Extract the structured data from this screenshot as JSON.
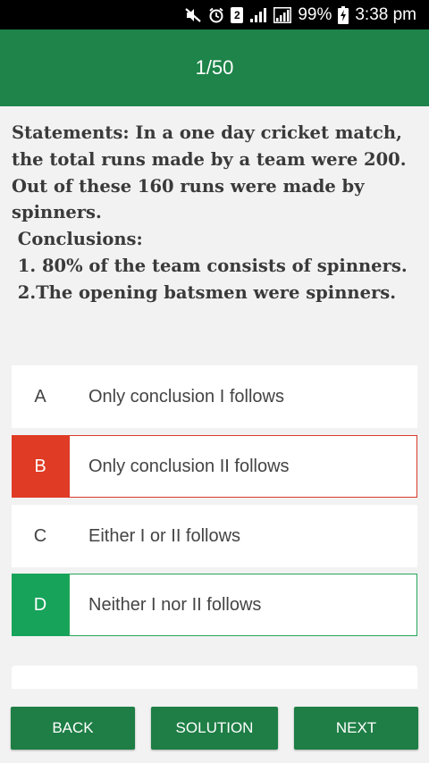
{
  "status_bar": {
    "sim_slot": "2",
    "battery": "99%",
    "time": "3:38 pm"
  },
  "header": {
    "progress": "1/50"
  },
  "question": {
    "text": "Statements: In a one day cricket match, the total runs made by a team were 200. Out of these 160 runs were made by spinners.\n Conclusions:\n 1. 80% of the team consists of spinners.\n 2.The opening batsmen were spinners."
  },
  "options": [
    {
      "letter": "A",
      "text": "Only conclusion I follows",
      "state": "default"
    },
    {
      "letter": "B",
      "text": "Only conclusion II follows",
      "state": "wrong"
    },
    {
      "letter": "C",
      "text": "Either I or II follows",
      "state": "default"
    },
    {
      "letter": "D",
      "text": "Neither I nor II follows",
      "state": "correct"
    }
  ],
  "buttons": {
    "back": "BACK",
    "solution": "SOLUTION",
    "next": "NEXT"
  },
  "colors": {
    "primary": "#1e8449",
    "wrong": "#e03b24",
    "correct": "#17a35a"
  }
}
